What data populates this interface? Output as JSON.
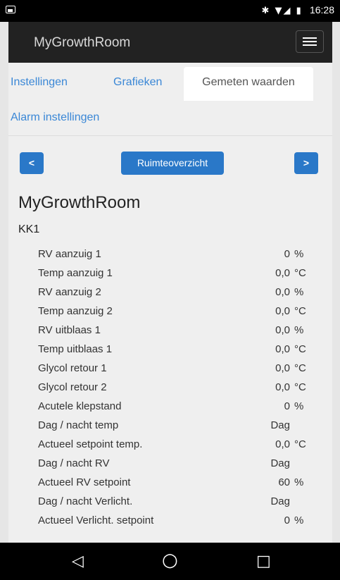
{
  "status_bar": {
    "icons": "✱ ▼◢ ▮",
    "time": "16:28"
  },
  "app": {
    "title": "MyGrowthRoom"
  },
  "tabs": [
    {
      "label": "Instellingen"
    },
    {
      "label": "Grafieken"
    },
    {
      "label": "Gemeten waarden"
    },
    {
      "label": "Alarm instellingen"
    }
  ],
  "toolbar": {
    "prev": "<",
    "center": "Ruimteoverzicht",
    "next": ">"
  },
  "page_title": "MyGrowthRoom",
  "section_title": "KK1",
  "rows": [
    {
      "label": "RV aanzuig 1",
      "value": "0",
      "unit": "%"
    },
    {
      "label": "Temp aanzuig 1",
      "value": "0,0",
      "unit": "°C"
    },
    {
      "label": "RV aanzuig 2",
      "value": "0,0",
      "unit": "%"
    },
    {
      "label": "Temp aanzuig 2",
      "value": "0,0",
      "unit": "°C"
    },
    {
      "label": "RV uitblaas 1",
      "value": "0,0",
      "unit": "%"
    },
    {
      "label": "Temp uitblaas 1",
      "value": "0,0",
      "unit": "°C"
    },
    {
      "label": "Glycol retour 1",
      "value": "0,0",
      "unit": "°C"
    },
    {
      "label": "Glycol retour 2",
      "value": "0,0",
      "unit": "°C"
    },
    {
      "label": "Acutele klepstand",
      "value": "0",
      "unit": "%"
    },
    {
      "label": "Dag / nacht temp",
      "value": "Dag",
      "unit": ""
    },
    {
      "label": "Actueel setpoint temp.",
      "value": "0,0",
      "unit": "°C"
    },
    {
      "label": "Dag / nacht RV",
      "value": "Dag",
      "unit": ""
    },
    {
      "label": "Actueel RV setpoint",
      "value": "60",
      "unit": "%"
    },
    {
      "label": "Dag / nacht Verlicht.",
      "value": "Dag",
      "unit": ""
    },
    {
      "label": "Actueel Verlicht. setpoint",
      "value": "0",
      "unit": "%"
    }
  ],
  "android_nav": {
    "back": "◁",
    "home": "○",
    "recents": "□"
  }
}
